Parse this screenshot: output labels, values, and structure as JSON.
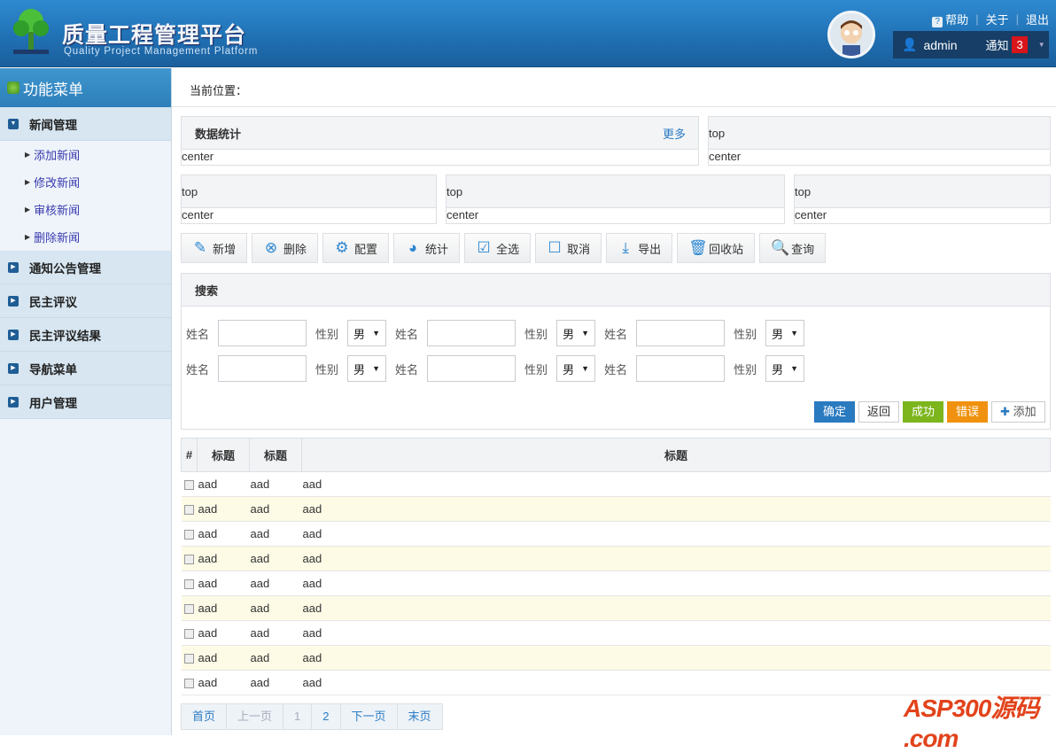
{
  "header": {
    "title": "质量工程管理平台",
    "subtitle": "Quality Project Management Platform",
    "links": [
      "帮助",
      "关于",
      "退出"
    ],
    "user": "admin",
    "notify_label": "通知",
    "notify_count": "3"
  },
  "sidebar": {
    "title": "功能菜单",
    "menus": [
      {
        "label": "新闻管理",
        "children": [
          "添加新闻",
          "修改新闻",
          "审核新闻",
          "删除新闻"
        ]
      },
      {
        "label": "通知公告管理"
      },
      {
        "label": "民主评议"
      },
      {
        "label": "民主评议结果"
      },
      {
        "label": "导航菜单"
      },
      {
        "label": "用户管理"
      }
    ]
  },
  "breadcrumb": "当前位置：",
  "panels": {
    "stats_title": "数据统计",
    "more": "更多",
    "top": "top",
    "center": "center"
  },
  "toolbar": [
    "新增",
    "删除",
    "配置",
    "统计",
    "全选",
    "取消",
    "导出",
    "回收站",
    "查询"
  ],
  "search": {
    "title": "搜索",
    "name_label": "姓名",
    "gender_label": "性别",
    "gender_value": "男"
  },
  "actions": {
    "ok": "确定",
    "back": "返回",
    "success": "成功",
    "error": "错误",
    "add": "添加"
  },
  "table": {
    "headers": [
      "#",
      "标题",
      "标题",
      "标题"
    ],
    "cell": "aad",
    "rows": 9
  },
  "pager": [
    "首页",
    "上一页",
    "1",
    "2",
    "下一页",
    "末页"
  ],
  "watermark": "ASP300源码 .com",
  "colors": {
    "header": "#1f6fb2",
    "ok": "#2a7ac0",
    "success": "#7cb51c",
    "error": "#f0920f"
  }
}
